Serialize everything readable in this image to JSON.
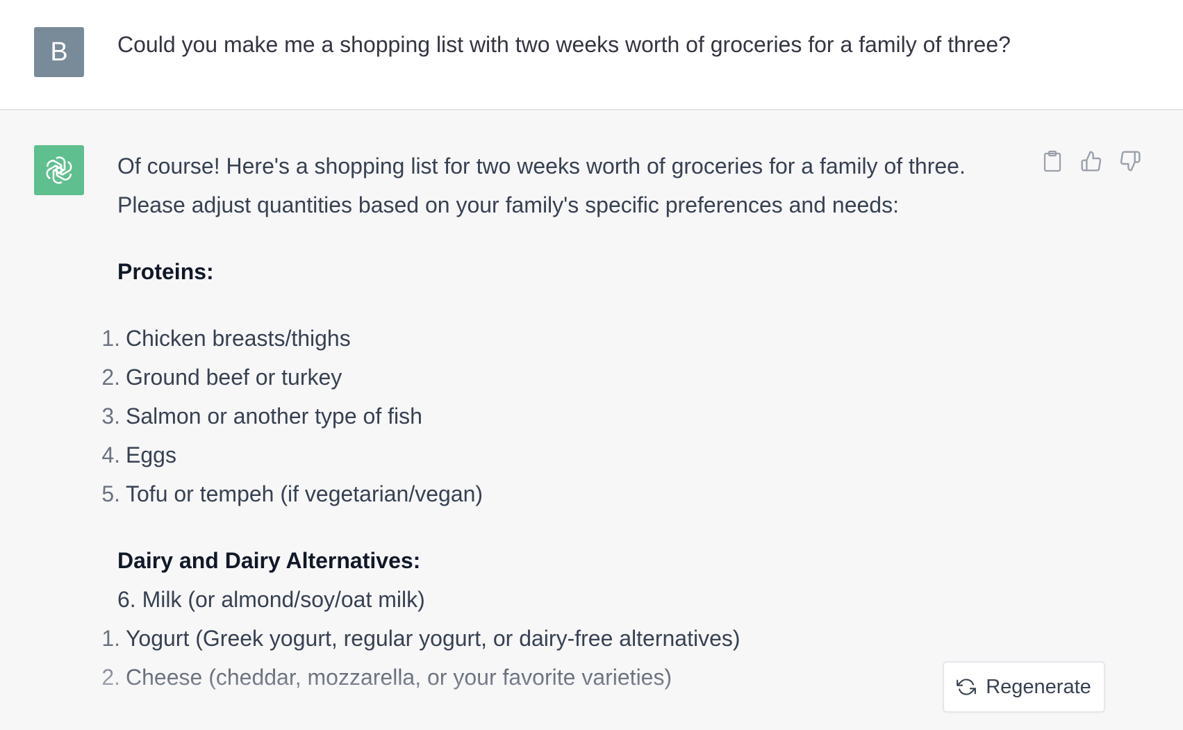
{
  "user_message": {
    "avatar_letter": "B",
    "text": "Could you make me a shopping list with two weeks worth of groceries for a family of three?"
  },
  "assistant_message": {
    "intro_line1": "Of course! Here's a shopping list for two weeks worth of groceries for a family of three.",
    "intro_line2": "Please adjust quantities based on your family's specific preferences and needs:",
    "proteins_heading": "Proteins:",
    "proteins": [
      {
        "num": "1.",
        "text": "Chicken breasts/thighs"
      },
      {
        "num": "2.",
        "text": "Ground beef or turkey"
      },
      {
        "num": "3.",
        "text": "Salmon or another type of fish"
      },
      {
        "num": "4.",
        "text": "Eggs"
      },
      {
        "num": "5.",
        "text": "Tofu or tempeh (if vegetarian/vegan)"
      }
    ],
    "dairy_heading": "Dairy and Dairy Alternatives:",
    "dairy_first": "6. Milk (or almond/soy/oat milk)",
    "dairy": [
      {
        "num": "1.",
        "text": "Yogurt (Greek yogurt, regular yogurt, or dairy-free alternatives)"
      },
      {
        "num": "2.",
        "text": "Cheese (cheddar, mozzarella, or your favorite varieties)"
      }
    ]
  },
  "actions": {
    "copy_icon": "clipboard-icon",
    "like_icon": "thumbs-up-icon",
    "dislike_icon": "thumbs-down-icon"
  },
  "regenerate": {
    "icon": "refresh-icon",
    "label": "Regenerate"
  },
  "colors": {
    "user_avatar": "#798b99",
    "bot_avatar": "#5fbf8e",
    "assistant_bg": "#f7f7f8"
  }
}
